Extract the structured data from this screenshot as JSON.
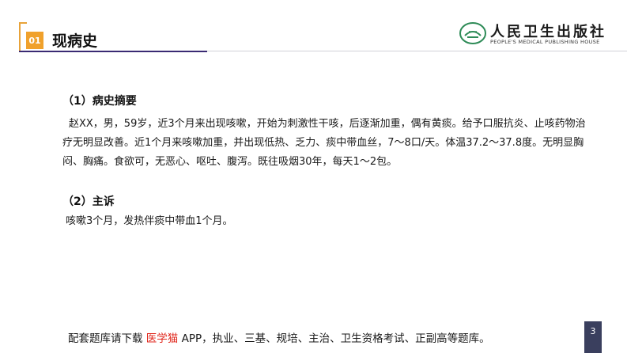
{
  "header": {
    "section_number": "01",
    "section_title": "现病史",
    "colors": {
      "accent": "#f0a12c",
      "rule": "#3a2a73"
    }
  },
  "logo": {
    "name": "人民卫生出版社",
    "subtitle": "PEOPLE'S MEDICAL PUBLISHING HOUSE",
    "icon": "pmph-emblem-icon"
  },
  "main": {
    "history_summary": {
      "heading": "（1）病史摘要",
      "text": "赵XX，男，59岁，近3个月来出现咳嗽，开始为刺激性干咳，后逐渐加重，偶有黄痰。给予口服抗炎、止咳药物治疗无明显改善。近1个月来咳嗽加重，并出现低热、乏力、痰中带血丝，7～8口/天。体温37.2～37.8度。无明显胸闷、胸痛。食欲可，无恶心、呕吐、腹泻。既往吸烟30年，每天1～2包。"
    },
    "chief_complaint": {
      "heading": "（2）主诉",
      "text": "咳嗽3个月，发热伴痰中带血1个月。"
    }
  },
  "footer": {
    "note_prefix": "配套题库请下载",
    "note_highlight": "医学猫",
    "note_suffix": "APP，执业、三基、规培、主治、卫生资格考试、正副高等题库。",
    "highlight_color": "#e0261b",
    "page_number": "3"
  }
}
